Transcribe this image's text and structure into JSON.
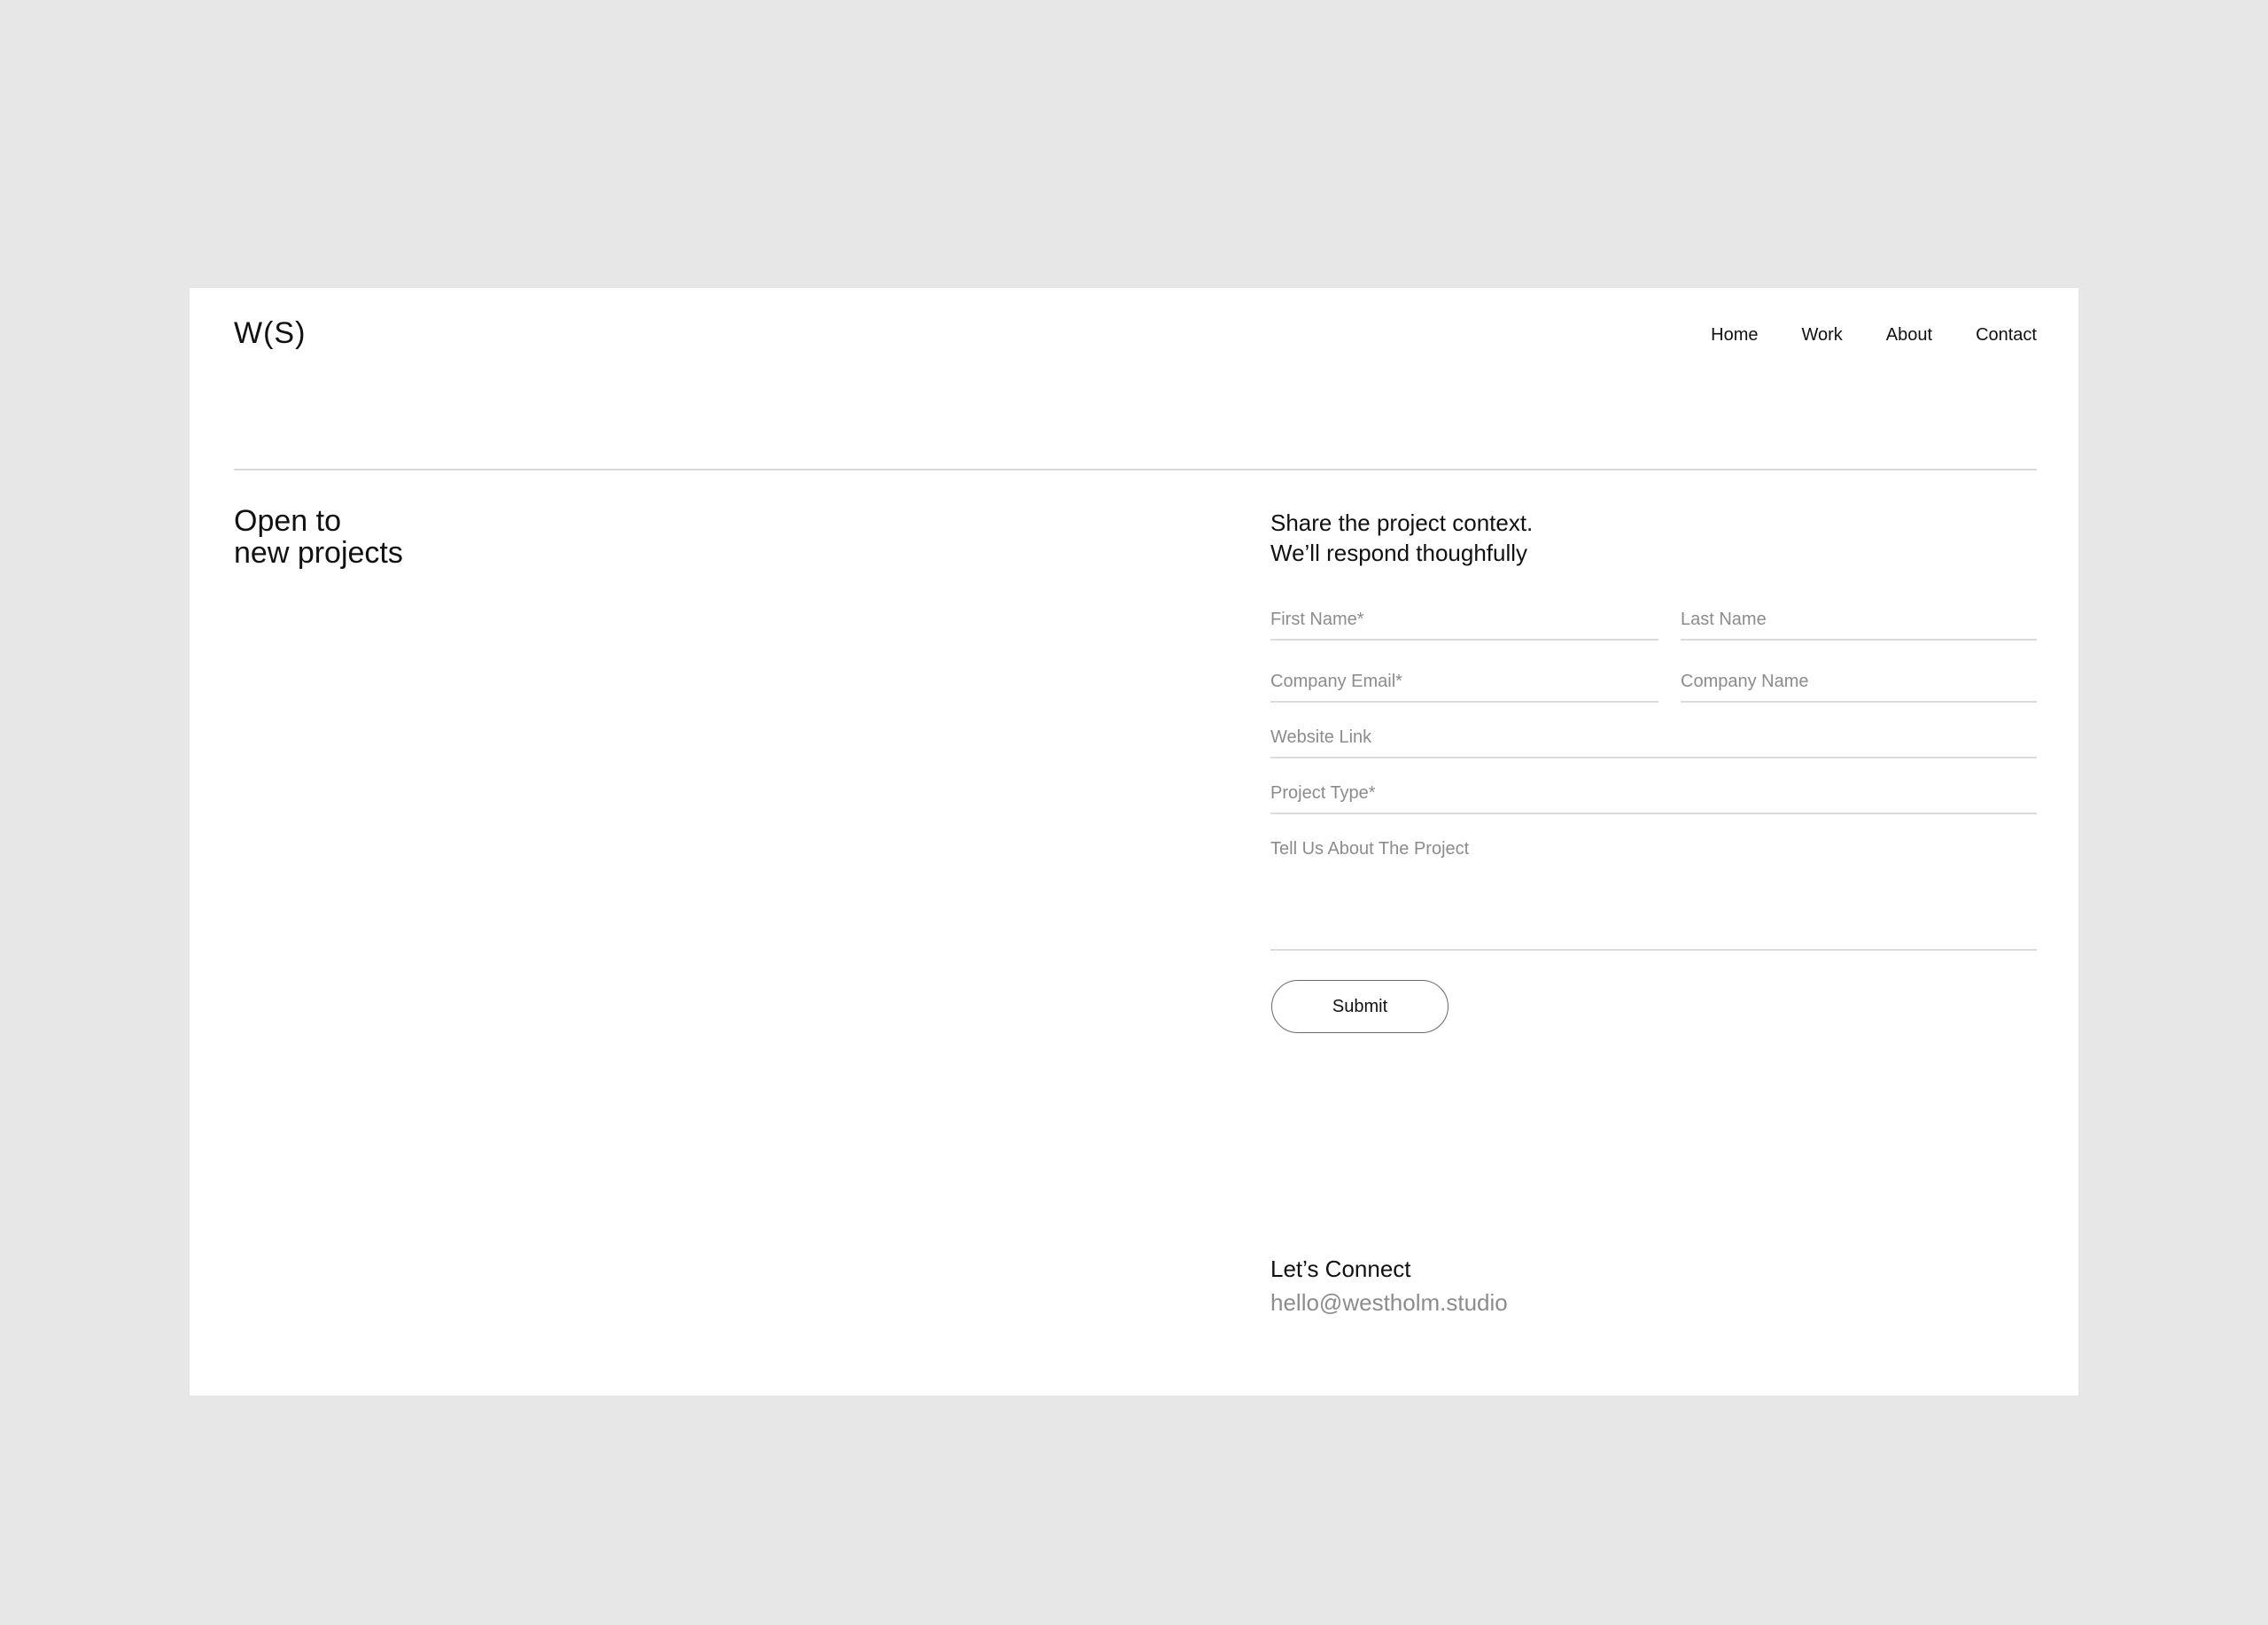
{
  "header": {
    "logo": "W(S)",
    "nav": [
      "Home",
      "Work",
      "About",
      "Contact"
    ]
  },
  "hero": {
    "headline": "Open to\nnew projects"
  },
  "form": {
    "intro": "Share the project context.\nWe’ll respond thoughfully",
    "first_name_placeholder": "First Name*",
    "last_name_placeholder": "Last Name",
    "company_email_placeholder": "Company Email*",
    "company_name_placeholder": "Company Name",
    "website_placeholder": "Website Link",
    "project_type_placeholder": "Project Type*",
    "about_placeholder": "Tell Us About The Project",
    "submit_label": "Submit"
  },
  "connect": {
    "title": "Let’s Connect",
    "email": "hello@westholm.studio"
  }
}
